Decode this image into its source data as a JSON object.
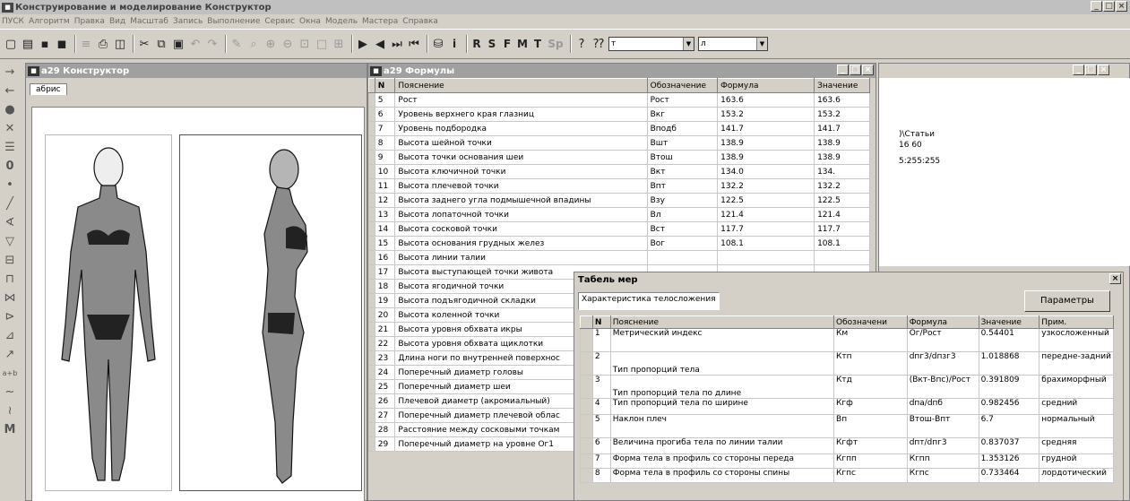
{
  "app": {
    "title": "Конструирование и моделирование  Конструктор",
    "icon": "app-icon"
  },
  "menu": [
    "ПУСК",
    "Алгоритм",
    "Правка",
    "Вид",
    "Масштаб",
    "Запись",
    "Выполнение",
    "Сервис",
    "Окна",
    "Модель",
    "Мастера",
    "Справка"
  ],
  "toolbar": {
    "letters": [
      "R",
      "S",
      "F",
      "M",
      "T",
      "Sp"
    ],
    "combo1": "т",
    "combo2": "л"
  },
  "constructor_window": {
    "title": "a29 Конструктор",
    "tab": "абрис"
  },
  "formulas_window": {
    "title": "a29 Формулы",
    "columns": [
      "N",
      "Пояснение",
      "Обозначение",
      "Формула",
      "Значение"
    ],
    "rows": [
      [
        "5",
        "Рост",
        "Рост",
        "163.6",
        "163.6"
      ],
      [
        "6",
        "Уровень верхнего края глазниц",
        "Вкг",
        "153.2",
        "153.2"
      ],
      [
        "7",
        "Уровень подбородка",
        "Вподб",
        "141.7",
        "141.7"
      ],
      [
        "8",
        "Высота шейной точки",
        "Вшт",
        "138.9",
        "138.9"
      ],
      [
        "9",
        "Высота точки основания шеи",
        "Втош",
        "138.9",
        "138.9"
      ],
      [
        "10",
        "Высота ключичной точки",
        "Вкт",
        "134.0",
        "134."
      ],
      [
        "11",
        "Высота плечевой точки",
        "Впт",
        "132.2",
        "132.2"
      ],
      [
        "12",
        "Высота заднего угла подмышечной впадины",
        "Взу",
        "122.5",
        "122.5"
      ],
      [
        "13",
        "Высота лопаточной точки",
        "Вл",
        "121.4",
        "121.4"
      ],
      [
        "14",
        "Высота сосковой точки",
        "Вст",
        "117.7",
        "117.7"
      ],
      [
        "15",
        "Высота основания грудных желез",
        "Вог",
        "108.1",
        "108.1"
      ],
      [
        "16",
        "Высота линии талии",
        "",
        "",
        ""
      ],
      [
        "17",
        "Высота выступающей точки живота",
        "",
        "",
        ""
      ],
      [
        "18",
        "Высота ягодичной точки",
        "",
        "",
        ""
      ],
      [
        "19",
        "Высота подъягодичной складки",
        "",
        "",
        ""
      ],
      [
        "20",
        "Высота коленной точки",
        "",
        "",
        ""
      ],
      [
        "21",
        "Высота уровня обхвата икры",
        "",
        "",
        ""
      ],
      [
        "22",
        "Высота уровня обхвата щиклотки",
        "",
        "",
        ""
      ],
      [
        "23",
        "Длина ноги по внутренней поверхнос",
        "",
        "",
        ""
      ],
      [
        "24",
        "Поперечный диаметр головы",
        "",
        "",
        ""
      ],
      [
        "25",
        "Поперечный диаметр шеи",
        "",
        "",
        ""
      ],
      [
        "26",
        "Плечевой диаметр (акромиальный)",
        "",
        "",
        ""
      ],
      [
        "27",
        "Поперечный диаметр плечевой облас",
        "",
        "",
        ""
      ],
      [
        "28",
        "Расстояние между сосковыми точкам",
        "",
        "",
        ""
      ],
      [
        "29",
        "Поперечный диаметр на уровне Ог1",
        "",
        "",
        ""
      ]
    ]
  },
  "right_window": {
    "lines": [
      ")\\Статьи",
      "16 60",
      "5:255:255"
    ]
  },
  "tabel": {
    "title": "Табель мер",
    "field": "Характеристика телосложения",
    "button": "Параметры",
    "columns": [
      "N",
      "Пояснение",
      "Обозначени",
      "Формула",
      "Значение",
      "Прим."
    ],
    "rows": [
      [
        "1",
        "Метрический индекс",
        "Км",
        "Ог/Рост",
        "0.54401",
        "узкосложенный"
      ],
      [
        "2",
        "Тип пропорций тела",
        "Ктп",
        "dпг3/dпзг3",
        "1.018868",
        "передне-задний"
      ],
      [
        "3",
        "Тип пропорций тела по длине",
        "Ктд",
        "(Вкт-Впс)/Рост",
        "0.391809",
        "брахиморфный"
      ],
      [
        "4",
        "Тип пропорций тела по ширине",
        "Кгф",
        "dпа/dпб",
        "0.982456",
        "средний"
      ],
      [
        "5",
        "Наклон плеч",
        "Вп",
        "Втош-Впт",
        "6.7",
        "нормальный"
      ],
      [
        "6",
        "Величина прогиба тела по линии талии",
        "Кгфт",
        "dпт/dпг3",
        "0.837037",
        "средняя"
      ],
      [
        "7",
        "Форма тела в профиль со стороны переда",
        "Кгпп",
        "Кгпп",
        "1.353126",
        "грудной"
      ],
      [
        "8",
        "Форма тела в профиль со стороны спины",
        "Кгпс",
        "Кгпс",
        "0.733464",
        "лордотический"
      ]
    ]
  },
  "window_buttons": {
    "minimize": "_",
    "restore": "□",
    "close": "×"
  }
}
